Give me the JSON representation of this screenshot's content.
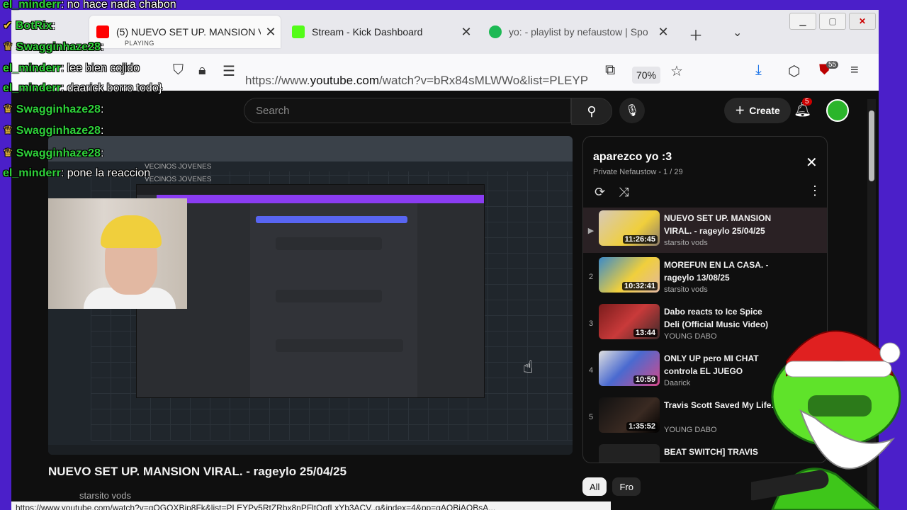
{
  "browser": {
    "tabs": [
      {
        "title": "(5) NUEVO SET UP. MANSION V",
        "status": "PLAYING",
        "fav_color": "#ff0000",
        "active": true
      },
      {
        "title": "Stream - Kick Dashboard",
        "fav_color": "#53fc18",
        "active": false
      },
      {
        "title": "yo: - playlist by nefaustow | Spo",
        "fav_color": "#1db954",
        "active": false
      }
    ],
    "url_prefix": "https://www.",
    "url_domain": "youtube.com",
    "url_rest": "/watch?v=bRx84sMLWWo&list=PLEYP",
    "zoom": "70%",
    "extension_badge": "55",
    "status_url": "https://www.youtube.com/watch?v=gOGOXBip8Fk&list=PLEYPy5RtZRbx8nPFltOgfLxYb3ACV..g&index=4&pp=gAQBiAQBsA..."
  },
  "youtube": {
    "search_placeholder": "Search",
    "create_label": "Create",
    "notification_count": "5",
    "video_title": "NUEVO SET UP. MANSION VIRAL. - rageylo 25/04/25",
    "video_channel": "starsito vods",
    "chips": [
      "All",
      "Fro"
    ],
    "playlist": {
      "title": "aparezco yo :3",
      "subtitle": "Private Nefaustow - 1 / 29",
      "items": [
        {
          "index": "▶",
          "title": "NUEVO SET UP. MANSION VIRAL. - rageylo 25/04/25",
          "channel": "starsito vods",
          "duration": "11:26:45"
        },
        {
          "index": "2",
          "title": "MOREFUN EN LA CASA. - rageylo 13/08/25",
          "channel": "starsito vods",
          "duration": "10:32:41"
        },
        {
          "index": "3",
          "title": "Dabo reacts to Ice Spice Deli (Official Music Video)",
          "channel": "YOUNG DABO",
          "duration": "13:44"
        },
        {
          "index": "4",
          "title": "ONLY UP pero MI CHAT controla EL JUEGO",
          "channel": "Daarick",
          "duration": "10:59"
        },
        {
          "index": "5",
          "title": "Travis Scott Saved My Life.",
          "channel": "YOUNG DABO",
          "duration": "1:35:52"
        },
        {
          "index": "",
          "title": "BEAT SWITCH] TRAVIS",
          "channel": "",
          "duration": ""
        }
      ]
    }
  },
  "stream_overlay": {
    "webcam_track_labels": [
      "VECINOS JOVENES",
      "VECINOS JOVENES"
    ],
    "chat": [
      {
        "user": "el_minderr",
        "text": "no hace nada chabon",
        "color": "#2fd13a"
      },
      {
        "user": "BotRix",
        "text": "",
        "color": "#2fd13a"
      },
      {
        "user": "Swagginhaze28",
        "text": "",
        "color": "#2fd13a"
      },
      {
        "user": "el_minderr",
        "text": "lee bien cojido",
        "color": "#2fd13a"
      },
      {
        "user": "el_minderr",
        "text": "daarick borro todo}",
        "color": "#2fd13a"
      },
      {
        "user": "Swagginhaze28",
        "text": "",
        "color": "#2fd13a"
      },
      {
        "user": "Swagginhaze28",
        "text": "",
        "color": "#2fd13a"
      },
      {
        "user": "Swagginhaze28",
        "text": "",
        "color": "#2fd13a"
      },
      {
        "user": "el_minderr",
        "text": "pone la reaccion",
        "color": "#2fd13a"
      }
    ]
  },
  "colors": {
    "overlay_bg": "#4b1fc9",
    "yt_bg": "#0f0f0f",
    "accent_red": "#cc0000"
  }
}
